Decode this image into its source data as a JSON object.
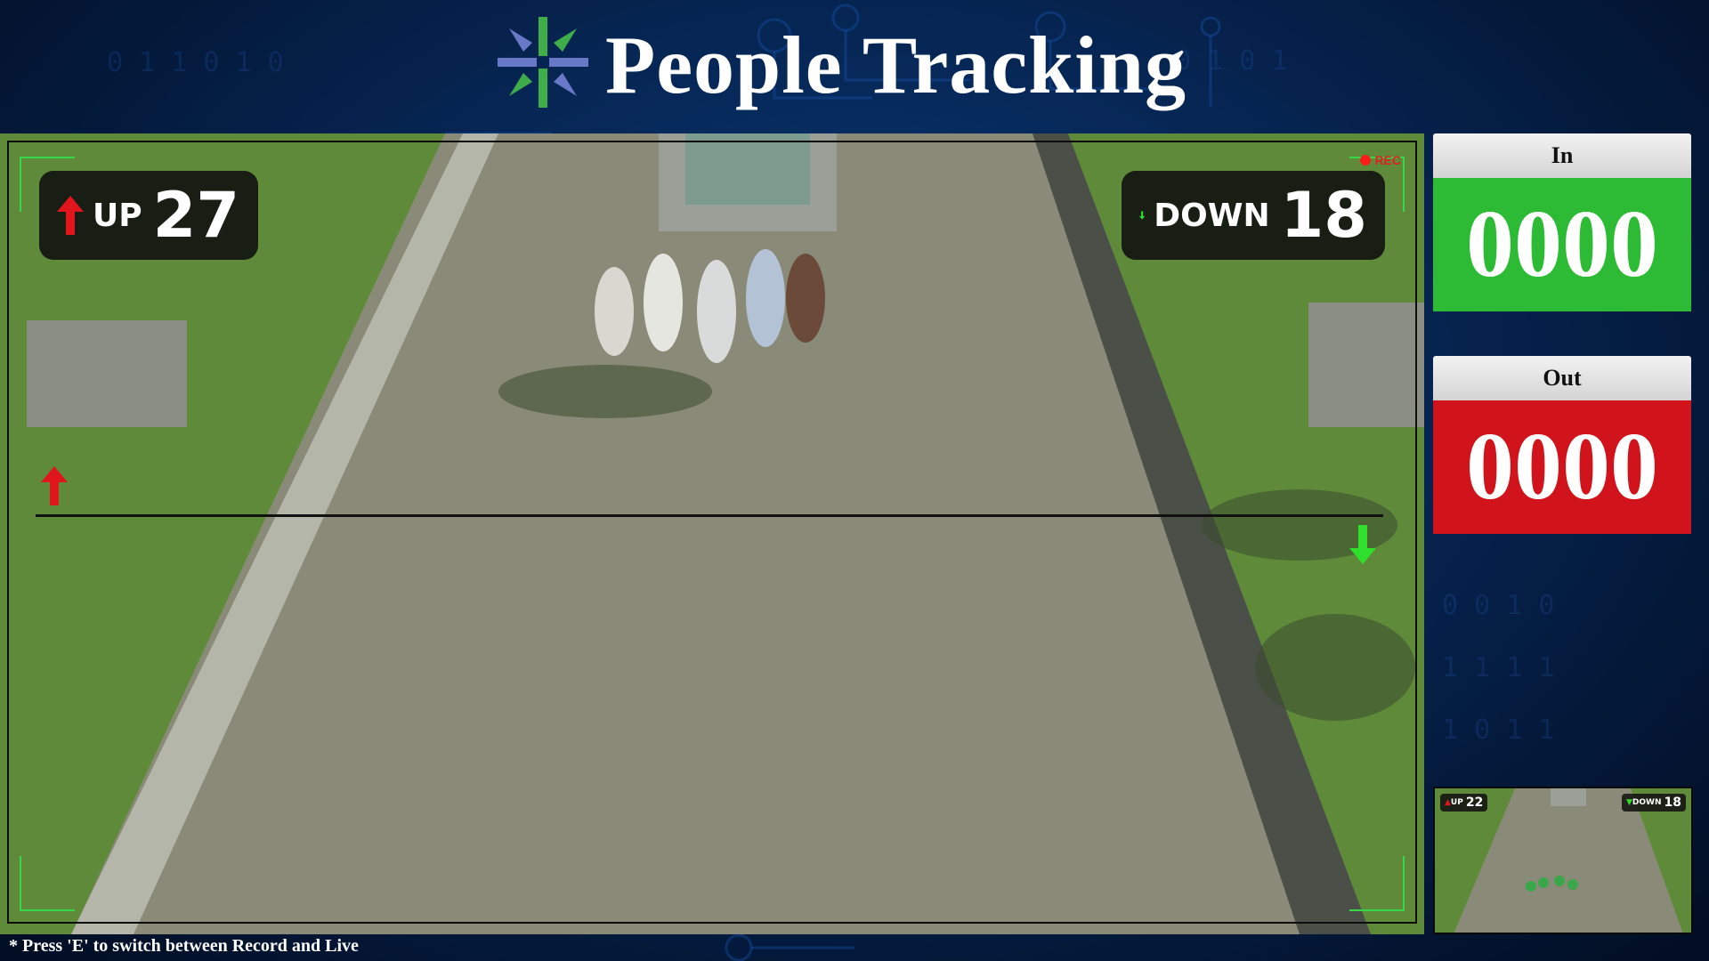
{
  "header": {
    "title": "People Tracking",
    "logo_icon": "asterisk-arrows-logo"
  },
  "feed": {
    "rec_label": "REC",
    "up_label": "UP",
    "up_count": "27",
    "down_label": "DOWN",
    "down_count": "18"
  },
  "panel": {
    "in_label": "In",
    "in_value": "0000",
    "out_label": "Out",
    "out_value": "0000"
  },
  "thumbnail": {
    "up_label": "UP",
    "up_count": "22",
    "down_label": "DOWN",
    "down_count": "18"
  },
  "footer": {
    "note": "* Press 'E' to switch between Record and Live"
  },
  "colors": {
    "in_green": "#2dbb35",
    "out_red": "#d1141b",
    "accent_blue": "#0b3a78"
  }
}
